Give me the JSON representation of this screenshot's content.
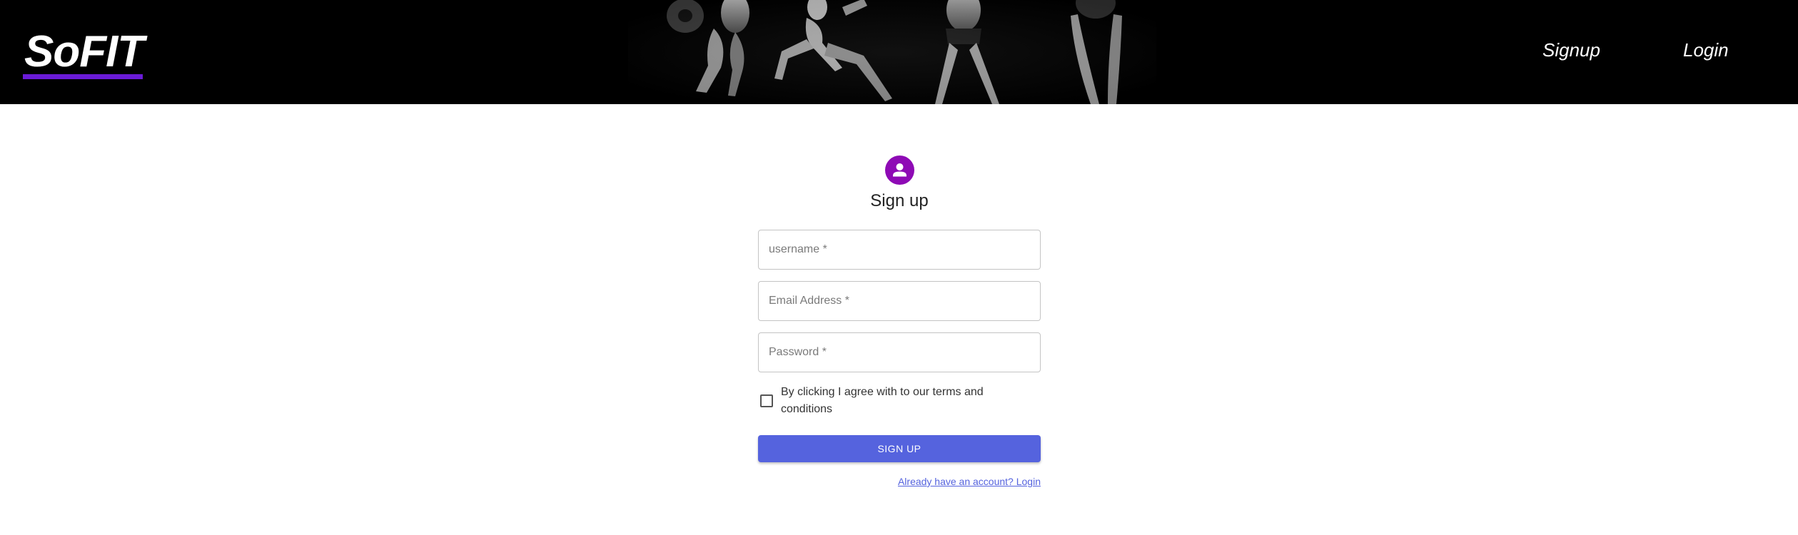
{
  "header": {
    "logo_text": "SoFIT",
    "nav": {
      "signup_label": "Signup",
      "login_label": "Login"
    },
    "hero_image": "athletes-bw-photo"
  },
  "form": {
    "avatar_icon": "person-icon",
    "avatar_color": "#8e0ab5",
    "title": "Sign up",
    "username": {
      "placeholder": "username *",
      "value": ""
    },
    "email": {
      "placeholder": "Email Address *",
      "value": ""
    },
    "password": {
      "placeholder": "Password *",
      "value": ""
    },
    "terms_checkbox": {
      "label": "By clicking I agree with to our terms and conditions",
      "checked": false
    },
    "submit_label": "SIGN UP",
    "submit_color": "#5563de",
    "login_link": "Already have an account? Login"
  },
  "colors": {
    "header_bg": "#000000",
    "logo_underline": "#6a1bd6"
  }
}
